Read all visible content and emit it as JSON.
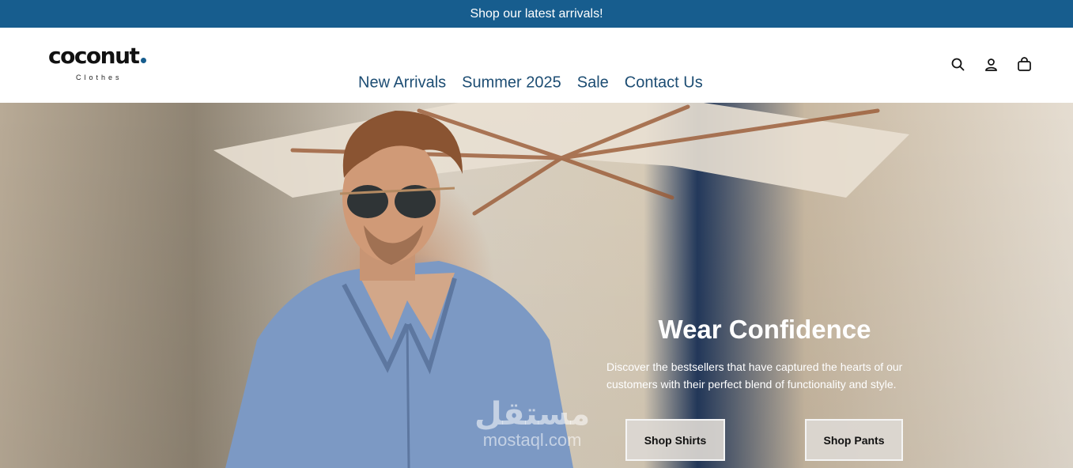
{
  "announcement": {
    "text": "Shop our latest arrivals!"
  },
  "brand": {
    "name": "coconut",
    "tagline": "Clothes",
    "accent": "#175d8e"
  },
  "nav": {
    "items": [
      "New Arrivals",
      "Summer 2025",
      "Sale",
      "Contact Us"
    ]
  },
  "header_icons": [
    "search-icon",
    "account-icon",
    "cart-icon"
  ],
  "hero": {
    "title": "Wear Confidence",
    "description": "Discover the bestsellers that have captured the hearts of our customers with their perfect blend of functionality and style.",
    "buttons": [
      "Shop Shirts",
      "Shop Pants"
    ]
  },
  "watermark": {
    "arabic": "مستقل",
    "latin": "mostaql.com"
  }
}
